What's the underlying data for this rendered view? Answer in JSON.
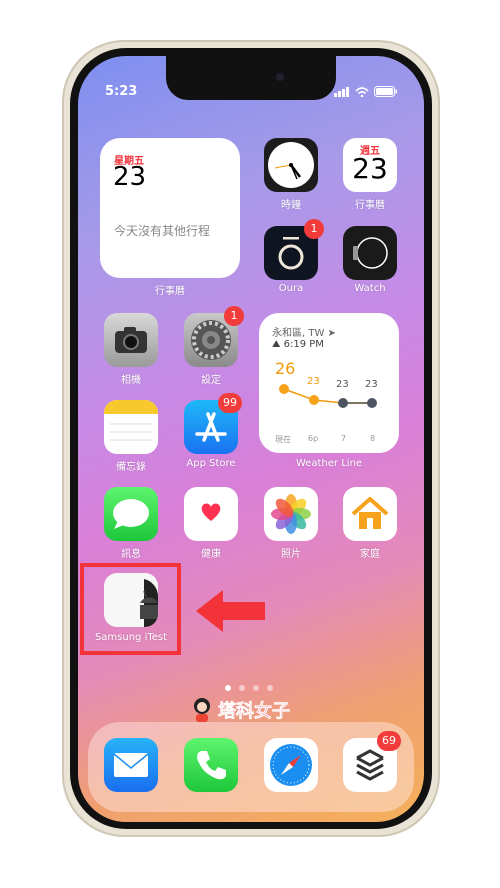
{
  "status_bar": {
    "time": "5:23"
  },
  "calendar_widget": {
    "weekday": "星期五",
    "day": "23",
    "message": "今天沒有其他行程",
    "label": "行事曆"
  },
  "apps": [
    {
      "id": "clock",
      "label": "時鐘"
    },
    {
      "id": "calendar",
      "label": "行事曆",
      "weekday": "週五",
      "day": "23"
    },
    {
      "id": "oura",
      "label": "Oura",
      "badge": "1"
    },
    {
      "id": "watch",
      "label": "Watch"
    },
    {
      "id": "camera",
      "label": "相機"
    },
    {
      "id": "settings",
      "label": "設定",
      "badge": "1"
    },
    {
      "id": "notes",
      "label": "備忘錄"
    },
    {
      "id": "appstore",
      "label": "App Store",
      "badge": "99"
    },
    {
      "id": "messages",
      "label": "訊息"
    },
    {
      "id": "health",
      "label": "健康"
    },
    {
      "id": "photos",
      "label": "照片"
    },
    {
      "id": "home",
      "label": "家庭"
    },
    {
      "id": "samsung",
      "label": "Samsung iTest"
    }
  ],
  "weather_widget": {
    "location": "永和區, TW",
    "sunset": "6:19 PM",
    "current": "26",
    "label": "Weather Line",
    "temps": [
      "23",
      "23",
      "23"
    ],
    "times": [
      "現在",
      "6p",
      "7",
      "8"
    ]
  },
  "page_dots": {
    "count": 4,
    "active": 0
  },
  "watermark": "塔科女子",
  "dock": [
    {
      "id": "mail"
    },
    {
      "id": "phone"
    },
    {
      "id": "safari"
    },
    {
      "id": "todoist",
      "badge": "69"
    }
  ],
  "colors": {
    "highlight": "#f2333a",
    "badge": "#f23b3b",
    "weather_orange": "#f29a0c"
  }
}
